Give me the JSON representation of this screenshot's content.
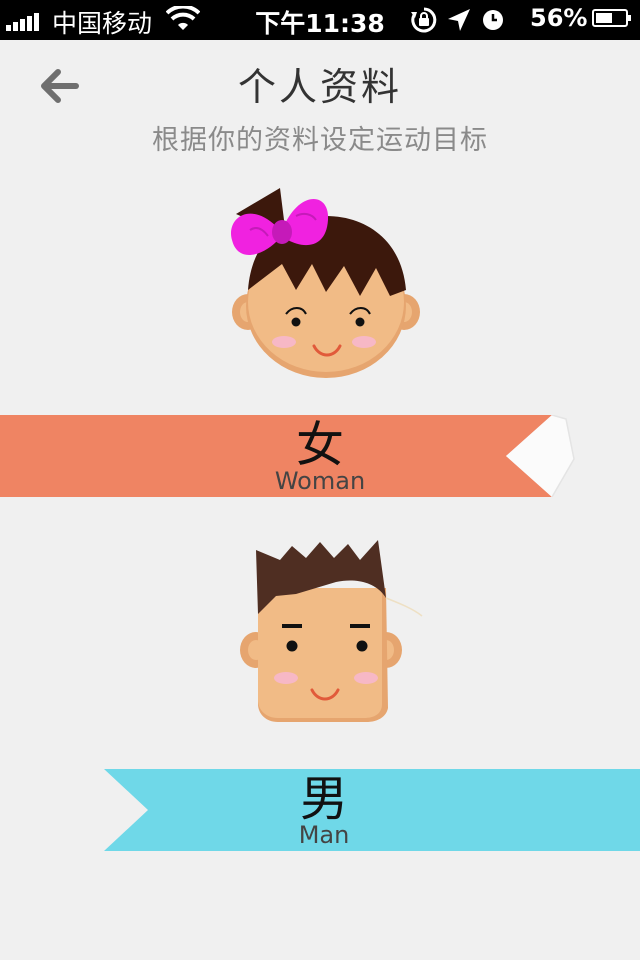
{
  "status_bar": {
    "carrier": "中国移动",
    "time": "下午11:38",
    "battery_percent": "56%",
    "battery_level": 0.56,
    "icons": [
      "signal-icon",
      "wifi-icon",
      "rotation-lock-icon",
      "location-icon",
      "alarm-icon",
      "battery-icon"
    ]
  },
  "header": {
    "title": "个人资料",
    "subtitle": "根据你的资料设定运动目标",
    "back_icon": "back-arrow-icon"
  },
  "options": {
    "woman": {
      "label_zh": "女",
      "label_en": "Woman",
      "color": "#ef8463"
    },
    "man": {
      "label_zh": "男",
      "label_en": "Man",
      "color": "#6fd8e8"
    }
  }
}
